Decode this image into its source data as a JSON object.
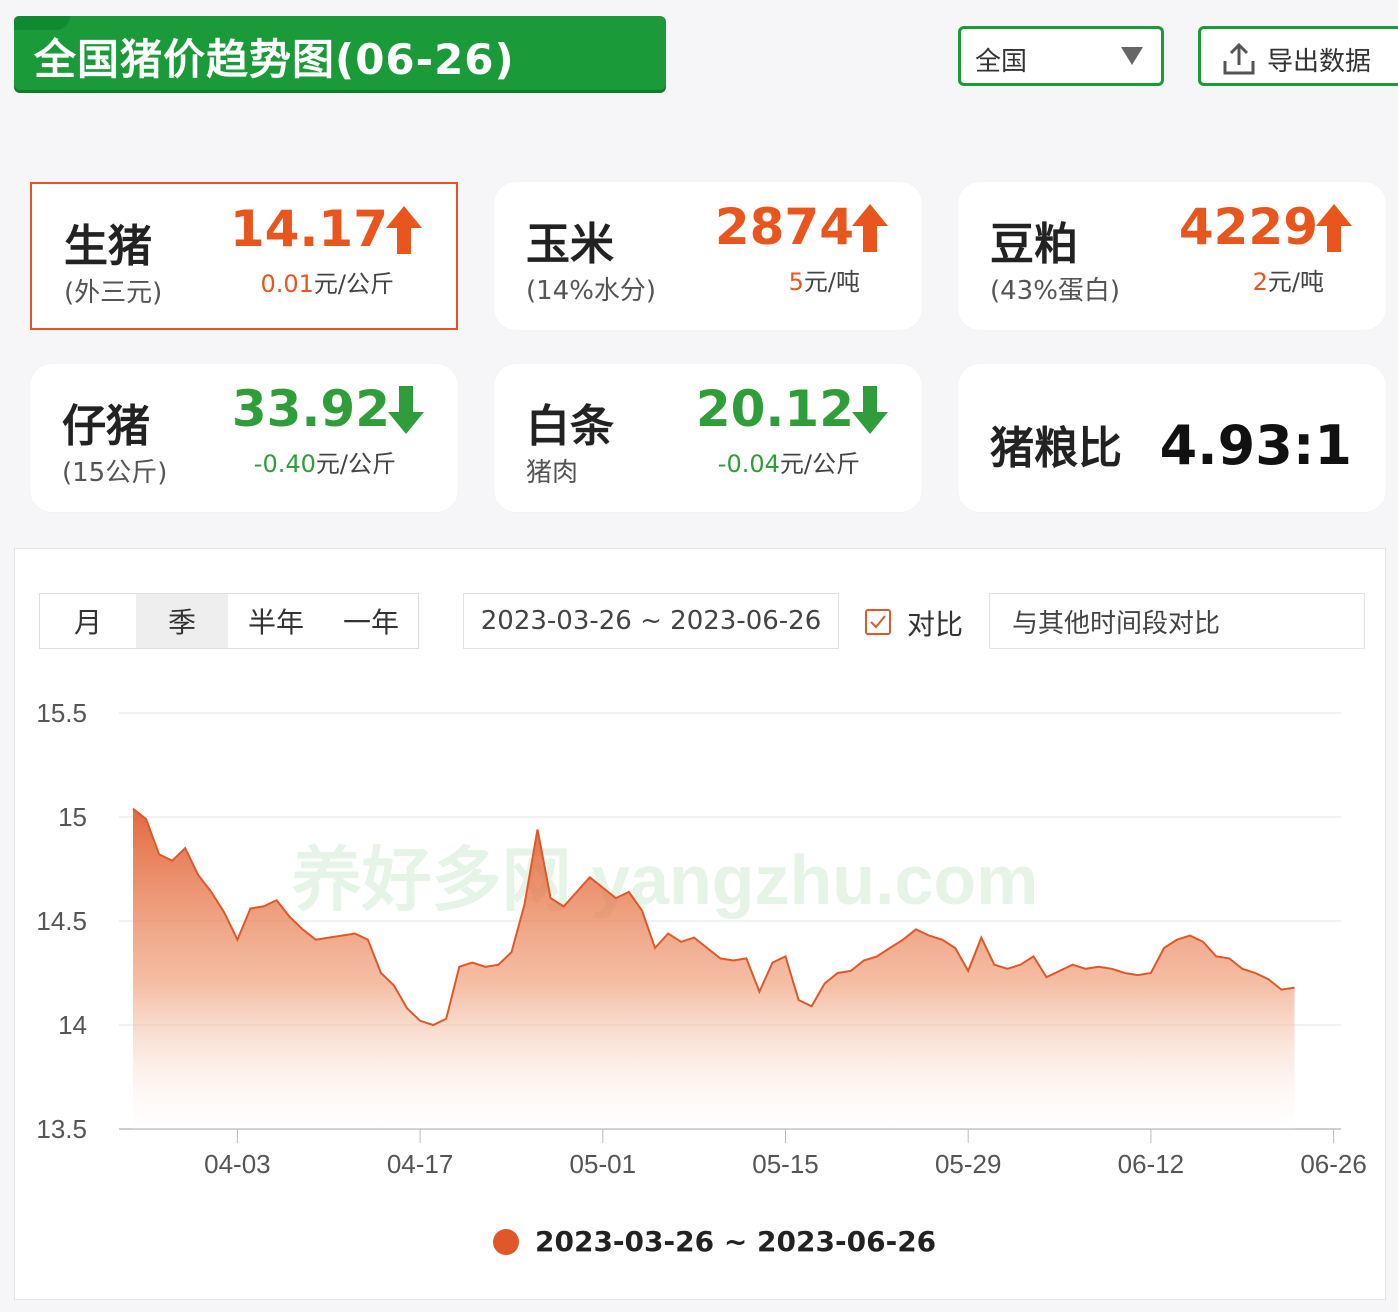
{
  "header": {
    "title": "全国猪价趋势图(06-26)",
    "region_value": "全国",
    "export_label": "导出数据"
  },
  "cards": [
    {
      "name": "生猪",
      "sub": "(外三元)",
      "price": "14.17",
      "trend": "up",
      "change": "0.01",
      "unit": "元/公斤"
    },
    {
      "name": "玉米",
      "sub": "(14%水分)",
      "price": "2874",
      "trend": "up",
      "change": "5",
      "unit": "元/吨"
    },
    {
      "name": "豆粕",
      "sub": "(43%蛋白)",
      "price": "4229",
      "trend": "up",
      "change": "2",
      "unit": "元/吨"
    },
    {
      "name": "仔猪",
      "sub": "(15公斤)",
      "price": "33.92",
      "trend": "down",
      "change": "-0.40",
      "unit": "元/公斤"
    },
    {
      "name": "白条",
      "sub": "猪肉",
      "price": "20.12",
      "trend": "down",
      "change": "-0.04",
      "unit": "元/公斤"
    },
    {
      "name": "猪粮比",
      "ratio": "4.93:1"
    }
  ],
  "controls": {
    "range_tabs": [
      "月",
      "季",
      "半年",
      "一年"
    ],
    "active_tab": "季",
    "date_range": "2023-03-26 ~ 2023-06-26",
    "compare_checked": true,
    "compare_label": "对比",
    "compare_placeholder": "与其他时间段对比"
  },
  "colors": {
    "brand_green": "#1a9a38",
    "up": "#e9561d",
    "down": "#2f9e3a",
    "series": "#e0582a"
  },
  "chart_data": {
    "type": "area",
    "ylim": [
      13.5,
      15.5
    ],
    "y_ticks": [
      "15.5",
      "15",
      "14.5",
      "14",
      "13.5"
    ],
    "x_ticks": [
      "04-03",
      "04-17",
      "05-01",
      "05-15",
      "05-29",
      "06-12",
      "06-26"
    ],
    "start_date": "2023-03-26",
    "grid": true,
    "series": [
      {
        "name": "2023-03-26 ~ 2023-06-26",
        "values": [
          15.04,
          14.99,
          14.82,
          14.79,
          14.85,
          14.72,
          14.64,
          14.54,
          14.41,
          14.56,
          14.57,
          14.6,
          14.52,
          14.46,
          14.41,
          14.42,
          14.43,
          14.44,
          14.41,
          14.25,
          14.19,
          14.08,
          14.02,
          14.0,
          14.03,
          14.28,
          14.3,
          14.28,
          14.29,
          14.35,
          14.58,
          14.94,
          14.61,
          14.57,
          14.64,
          14.71,
          14.66,
          14.61,
          14.64,
          14.55,
          14.37,
          14.44,
          14.4,
          14.42,
          14.37,
          14.32,
          14.31,
          14.32,
          14.16,
          14.3,
          14.33,
          14.12,
          14.09,
          14.2,
          14.25,
          14.26,
          14.31,
          14.33,
          14.37,
          14.41,
          14.46,
          14.43,
          14.41,
          14.37,
          14.26,
          14.42,
          14.29,
          14.27,
          14.29,
          14.33,
          14.23,
          14.26,
          14.29,
          14.27,
          14.28,
          14.27,
          14.25,
          14.24,
          14.25,
          14.37,
          14.41,
          14.43,
          14.4,
          14.33,
          14.32,
          14.27,
          14.25,
          14.22,
          14.17,
          14.18
        ]
      }
    ],
    "watermark": "养好多网 yangzhu.com"
  }
}
